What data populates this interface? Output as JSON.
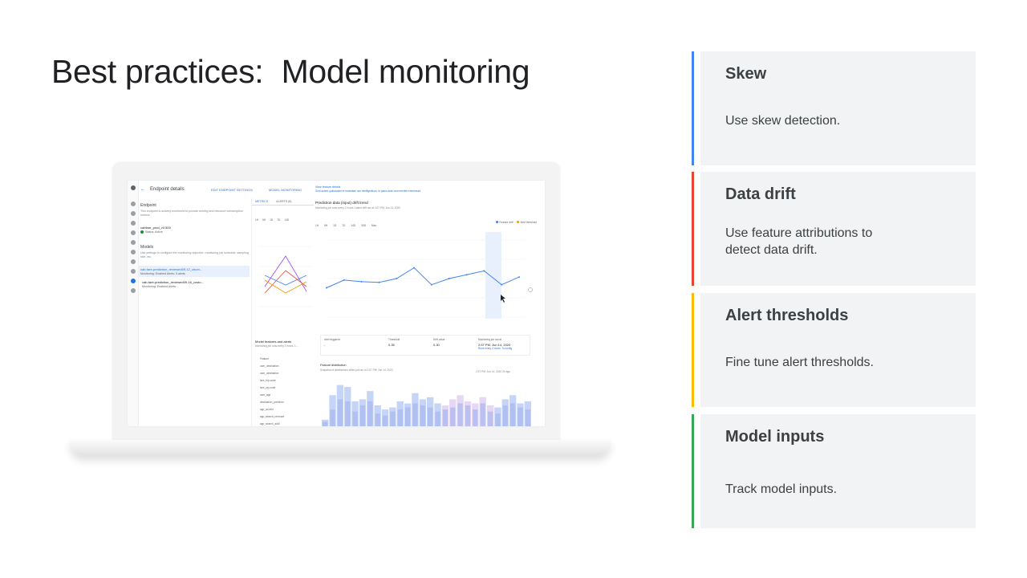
{
  "slide": {
    "title": "Best practices:  Model monitoring"
  },
  "cards": [
    {
      "title": "Skew",
      "body": "Use skew detection.",
      "color": "#4285f4"
    },
    {
      "title": "Data drift",
      "body": "Use feature attributions to detect data drift.",
      "color": "#ea4335"
    },
    {
      "title": "Alert thresholds",
      "body": "Fine tune alert thresholds.",
      "color": "#fbbc04"
    },
    {
      "title": "Model inputs",
      "body": "Track model inputs.",
      "color": "#34a853"
    }
  ],
  "console": {
    "page_title": "Endpoint details",
    "actions": [
      "EDIT ENDPOINT SETTINGS",
      "MODEL MONITORING"
    ],
    "left": {
      "section_endpoint": "Endpoint",
      "endpoint_desc": "This endpoint is actively monitored to provide serving and resource consumption metrics.",
      "endpoint_name": "cabfare_prod_v0.500",
      "endpoint_status": "Status: Active",
      "section_models": "Models",
      "models_desc": "Use settings to configure the monitoring objective, monitoring job schedule, sampling rate, etc.",
      "model_1": "cab-fare-prediction_reviewed09-12_chum...",
      "model_1_status": "Monitoring: Enabled   Alerts: 5 alerts",
      "model_2": "cab-fare-prediction_reviewed09-16_costo...",
      "model_2_status": "Monitoring: Enabled   Alerts: -"
    },
    "middle": {
      "tabs": [
        "METRICS",
        "ALERTS (6)"
      ],
      "chips": [
        "1H",
        "6H",
        "1D",
        "7D",
        "14D"
      ],
      "features_title": "Model features and alerts",
      "features_sub": "Monitoring job runs every 2 hours. L...",
      "features": [
        "Feature",
        "user_destination",
        "user_destination",
        "fare_trip-code",
        "fare_zip-code",
        "user_age",
        "destination_premium",
        "app_ad-info",
        "app_search_remount",
        "app_search_addl",
        "app_search_data"
      ]
    },
    "right": {
      "link": "View feature details",
      "link_sub": "Sunt autem quibusdam et molestiae non intelligentium, to paulo ante cum breviter exeremunt.",
      "drift_title": "Prediction data (input) drift trend",
      "drift_sub": "Monitoring job runs every 2 hours. Latest drift ran at 4:07 PM, Jun 14, 2020",
      "chips": [
        "1H",
        "6H",
        "1D",
        "7D",
        "14D",
        "30D",
        "Max"
      ],
      "legend": [
        "Feature drift",
        "Alert threshold"
      ],
      "table": {
        "alert_label": "Alert triggered",
        "alert_value": "-",
        "threshold_label": "Threshold",
        "threshold_value": "0.35",
        "drift_label": "Drift value",
        "drift_value": "0.30",
        "job_label": "Monitoring job ran at",
        "job_value": "2:57 PM, Jun 14, 2020",
        "job_sub": "Runs every 2 hours. To config"
      },
      "dist_title": "Feature distribution",
      "dist_sub": "Snapshot of distributions when job ran at 2:57 PM, Jun 14, 2020",
      "dist_meta": [
        "2:57 PM, Jun 14, 2020",
        "Zh ago"
      ],
      "line_values": [
        0.38,
        0.48,
        0.46,
        0.45,
        0.5,
        0.64,
        0.42,
        0.5,
        0.55,
        0.6,
        0.42,
        0.52
      ],
      "hist_a": [
        4,
        16,
        21,
        20,
        13,
        14,
        18,
        11,
        9,
        10,
        13,
        12,
        17,
        14,
        15,
        12,
        11,
        14,
        16,
        13,
        12,
        15,
        11,
        10,
        14,
        16,
        12,
        13
      ],
      "hist_b": [
        3,
        9,
        14,
        13,
        8,
        11,
        13,
        7,
        6,
        8,
        9,
        10,
        12,
        11,
        10,
        8,
        9,
        10,
        12,
        11,
        9,
        12,
        8,
        7,
        11,
        12,
        10,
        9
      ]
    }
  }
}
